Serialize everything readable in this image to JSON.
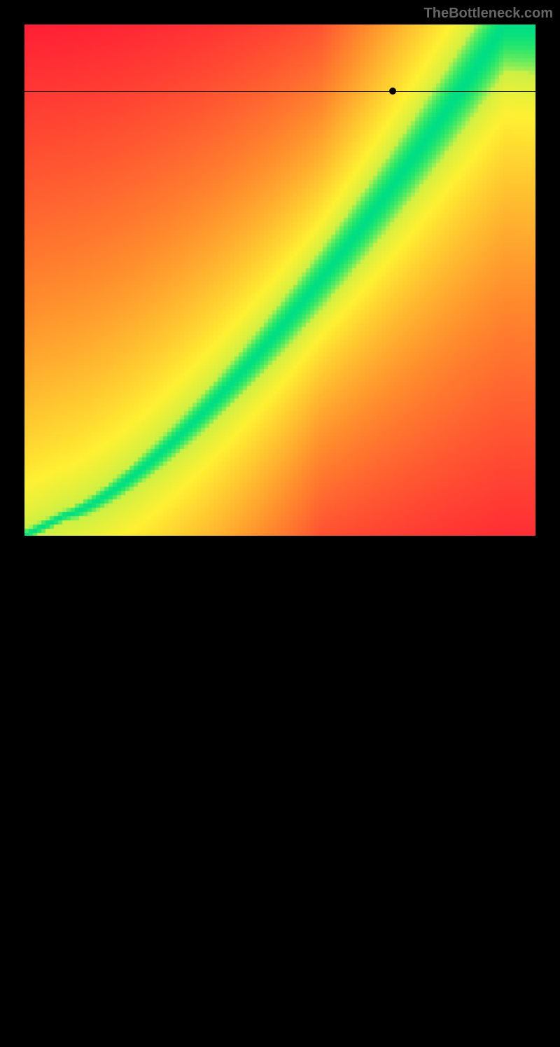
{
  "watermark": "TheBottleneck.com",
  "chart_data": {
    "type": "heatmap",
    "title": "",
    "xlabel": "",
    "ylabel": "",
    "xlim": [
      0,
      100
    ],
    "ylim": [
      0,
      100
    ],
    "marker": {
      "x": 72,
      "y": 87
    },
    "crosshair": {
      "vertical_x": 72,
      "horizontal_y": 87
    },
    "color_scale": {
      "min_color": "#ff0033",
      "mid_low_color": "#ff9933",
      "mid_color": "#ffff33",
      "optimal_color": "#00dd88",
      "description": "Red indicates bottleneck, green indicates optimal pairing"
    },
    "optimal_curve_description": "S-shaped diagonal curve from bottom-left to top-right representing optimal CPU-GPU pairing",
    "gradient_field": "Red in corners transitioning through orange and yellow toward green optimal band along diagonal curve"
  }
}
